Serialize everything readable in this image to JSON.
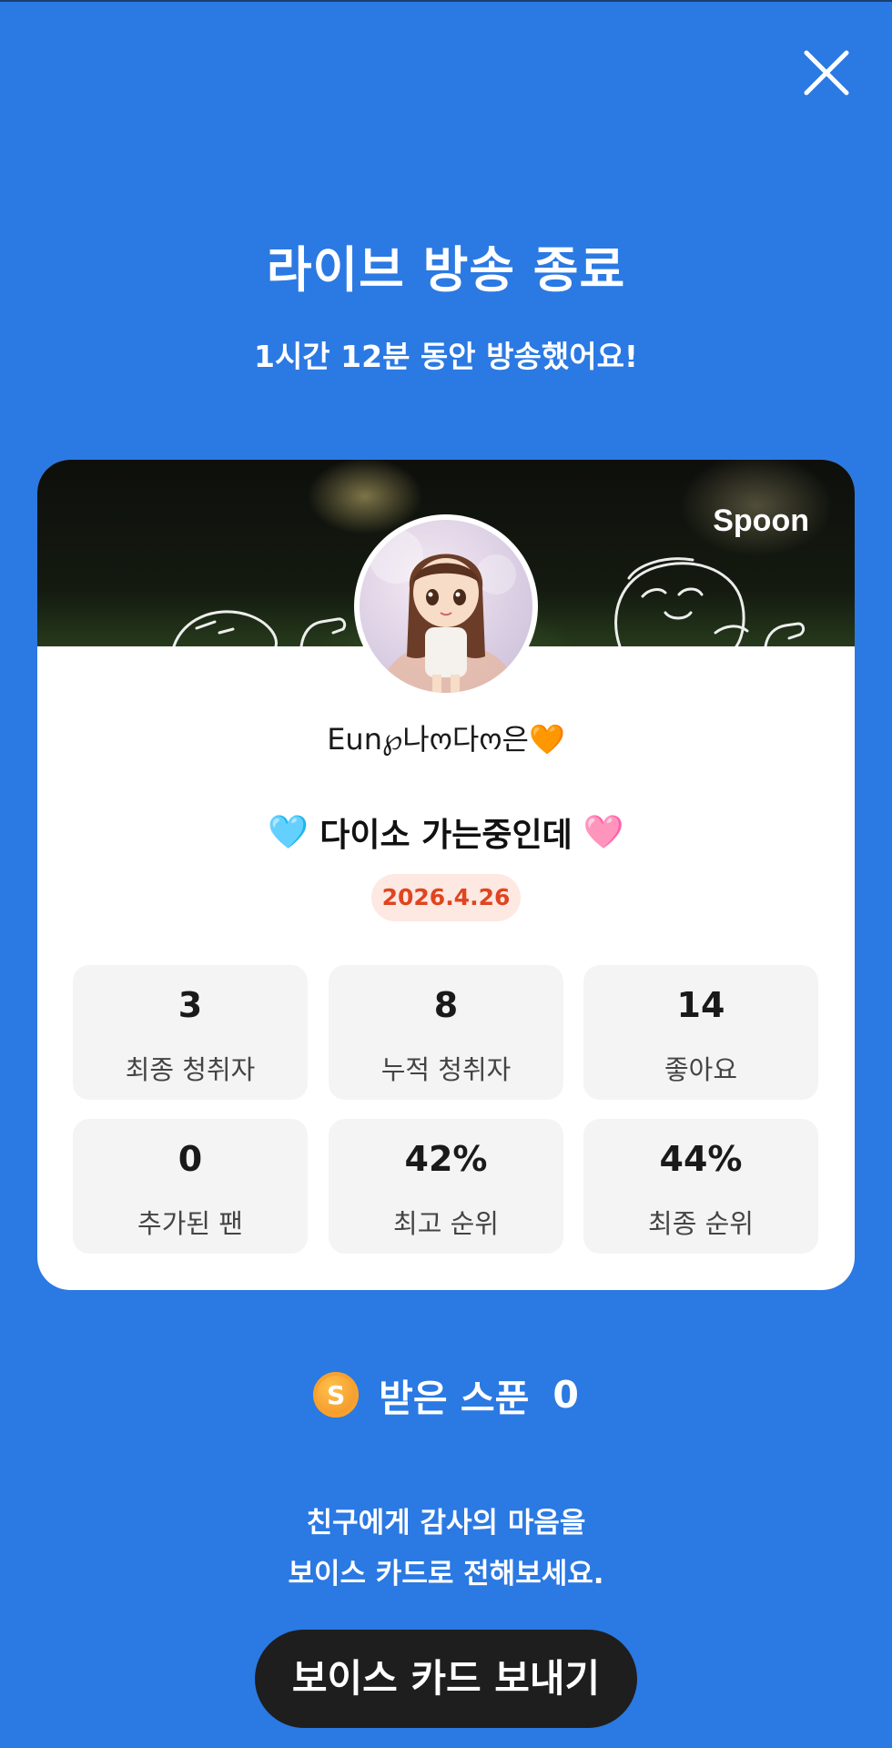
{
  "header": {
    "close_icon": "close-icon"
  },
  "title": "라이브 방송 종료",
  "subtitle": "1시간 12분 동안 방송했어요!",
  "card": {
    "brand": "Spoon",
    "nickname": "Eun℘나ო다ო은",
    "nickname_emoji": "🧡",
    "live_title": "다이소 가는중인데",
    "live_title_emoji_left": "🩵",
    "live_title_emoji_right": "🩷",
    "date": "2026.4.26",
    "stats": [
      {
        "value": "3",
        "label": "최종 청취자"
      },
      {
        "value": "8",
        "label": "누적 청취자"
      },
      {
        "value": "14",
        "label": "좋아요"
      },
      {
        "value": "0",
        "label": "추가된 팬"
      },
      {
        "value": "42%",
        "label": "최고 순위"
      },
      {
        "value": "44%",
        "label": "최종 순위"
      }
    ]
  },
  "spoons": {
    "coin_letter": "S",
    "label": "받은 스푼",
    "count": "0"
  },
  "thanks": {
    "line1": "친구에게 감사의 마음을",
    "line2": "보이스 카드로 전해보세요."
  },
  "send_button": "보이스 카드 보내기",
  "colors": {
    "background": "#2B79E3",
    "card": "#FFFFFF",
    "stat_box": "#F4F4F4",
    "date_badge_bg": "#FDE8E2",
    "date_badge_text": "#E0451F",
    "button": "#1E1E1E"
  }
}
